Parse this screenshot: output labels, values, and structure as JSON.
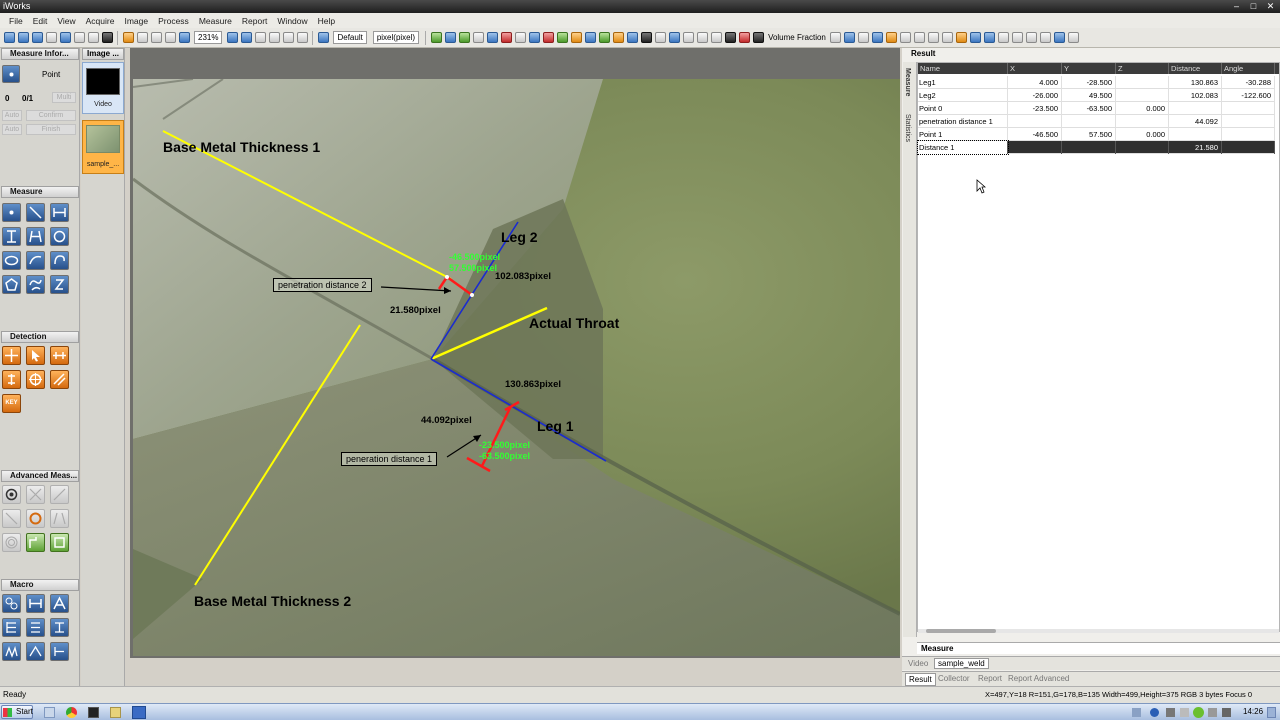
{
  "window": {
    "title": "iWorks"
  },
  "menu": [
    "File",
    "Edit",
    "View",
    "Acquire",
    "Image",
    "Process",
    "Measure",
    "Report",
    "Window",
    "Help"
  ],
  "toolbar": {
    "zoom": "231%",
    "profile": "Default",
    "unit": "pixel(pixel)",
    "volume_fraction": "Volume Fraction"
  },
  "left": {
    "measure_info": "Measure Infor...",
    "point_label": "Point",
    "count": "0",
    "fraction": "0/1",
    "multi": "Multi",
    "auto": "Auto",
    "confirm": "Confirm",
    "finish": "Finish",
    "measure": "Measure",
    "detection": "Detection",
    "key": "KEY",
    "advanced": "Advanced Meas...",
    "macro": "Macro"
  },
  "images": {
    "header": "Image ...",
    "thumb1": "Video",
    "thumb2": "sample_..."
  },
  "overlay": {
    "base1": "Base Metal Thickness 1",
    "base2": "Base Metal Thickness 2",
    "leg2": "Leg 2",
    "leg1": "Leg 1",
    "throat": "Actual Throat",
    "pen2": "penetration distance 2",
    "pen1": "peneration distance 1",
    "d102": "102.083pixel",
    "d21": "21.580pixel",
    "d130": "130.863pixel",
    "d44": "44.092pixel",
    "g1": "-46.500pixel",
    "g2": "57.500pixel",
    "g3": "-23.500pixel",
    "g4": "-63.500pixel"
  },
  "result": {
    "title": "Result",
    "side_measure": "Measure",
    "side_statistics": "Statistics",
    "columns": [
      "Name",
      "X",
      "Y",
      "Z",
      "Distance",
      "Angle"
    ],
    "rows": [
      [
        "Leg1",
        "4.000",
        "-28.500",
        "",
        "130.863",
        "-30.288"
      ],
      [
        "Leg2",
        "-26.000",
        "49.500",
        "",
        "102.083",
        "-122.600"
      ],
      [
        "Point 0",
        "-23.500",
        "-63.500",
        "0.000",
        "",
        ""
      ],
      [
        "penetration distance 1",
        "",
        "",
        "",
        "44.092",
        ""
      ],
      [
        "Point 1",
        "-46.500",
        "57.500",
        "0.000",
        "",
        ""
      ],
      [
        "Distance 1",
        "",
        "",
        "",
        "21.580",
        ""
      ]
    ],
    "measure_tab": "Measure",
    "tabs_top": [
      "Video",
      "sample_weld"
    ],
    "tabs_bottom": [
      "Result",
      "Collector",
      "Report",
      "Report Advanced"
    ]
  },
  "status": {
    "ready": "Ready",
    "info": "X=497,Y=18    R=151,G=178,B=135    Width=499,Height=375    RGB 3 bytes    Focus 0"
  },
  "taskbar": {
    "start": "Start",
    "clock": "14:26"
  },
  "colors": {
    "accent": "#3b76c0",
    "annot_yellow": "#ffff00",
    "annot_red": "#ff1a1a",
    "annot_green": "#33ff33",
    "annot_blue": "#1a2bd0"
  }
}
